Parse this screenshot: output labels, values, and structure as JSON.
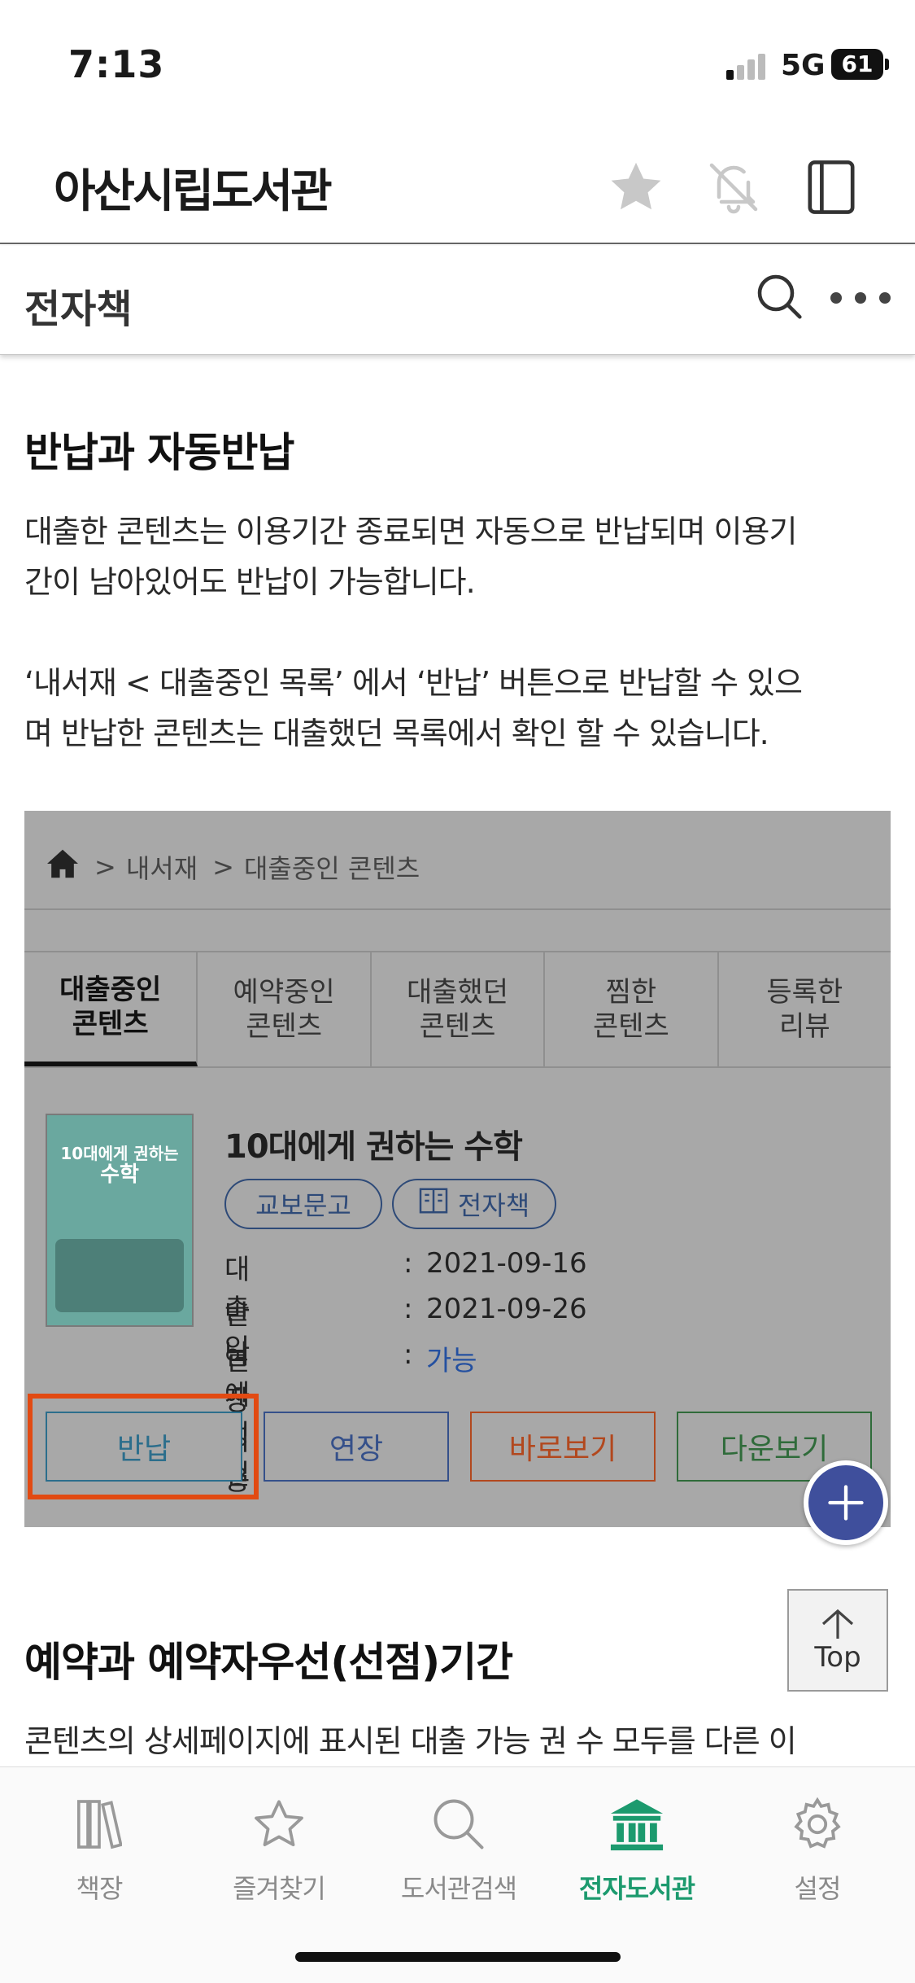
{
  "status_bar": {
    "time": "7:13",
    "network": "5G",
    "battery": "61"
  },
  "header": {
    "title": "아산시립도서관"
  },
  "section": {
    "title": "전자책"
  },
  "article": {
    "heading1": "반납과 자동반납",
    "para1_line1": "대출한 콘텐츠는 이용기간 종료되면 자동으로 반납되며 이용기",
    "para1_line2": "간이 남아있어도 반납이 가능합니다.",
    "para2_line1": "‘내서재 < 대출중인 목록’ 에서 ‘반납’ 버튼으로 반납할 수 있으",
    "para2_line2": "며 반납한 콘텐츠는 대출했던 목록에서 확인 할 수 있습니다.",
    "heading2": "예약과 예약자우선(선점)기간",
    "para3_line1": "콘텐츠의 상세페이지에 표시된 대출 가능 권 수 모두를 다른 이"
  },
  "screenshot": {
    "breadcrumb": [
      "내서재",
      "대출중인 콘텐츠"
    ],
    "tabs": [
      {
        "line1": "대출중인",
        "line2": "콘텐츠",
        "active": true
      },
      {
        "line1": "예약중인",
        "line2": "콘텐츠",
        "active": false
      },
      {
        "line1": "대출했던",
        "line2": "콘텐츠",
        "active": false
      },
      {
        "line1": "찜한",
        "line2": "콘텐츠",
        "active": false
      },
      {
        "line1": "등록한",
        "line2": "리뷰",
        "active": false
      }
    ],
    "cover_text_line1": "10대에게 권하는",
    "cover_text_line2": "수학",
    "book_title": "10대에게 권하는 수학",
    "publisher_tag": "교보문고",
    "type_tag": "전자책",
    "loan_date_label": "대출일",
    "loan_date": "2021-09-16",
    "due_date_label": "반납예정일",
    "due_date": "2021-09-26",
    "extend_label": "연장이용",
    "extend_value": "가능",
    "colon": ":",
    "buttons": {
      "return": "반납",
      "extend": "연장",
      "view": "바로보기",
      "download": "다운보기"
    },
    "colors": {
      "return": "#2c6e8c",
      "extend": "#35508a",
      "view": "#b2481e",
      "download": "#2f6b3a",
      "highlight": "#e24a12"
    }
  },
  "floating": {
    "top_label": "Top"
  },
  "bottom_nav": {
    "items": [
      {
        "label": "책장",
        "icon": "bookshelf-icon"
      },
      {
        "label": "즐겨찾기",
        "icon": "star-icon"
      },
      {
        "label": "도서관검색",
        "icon": "search-icon"
      },
      {
        "label": "전자도서관",
        "icon": "library-icon",
        "active": true
      },
      {
        "label": "설정",
        "icon": "gear-icon"
      }
    ],
    "active_color": "#1c9a6e"
  }
}
